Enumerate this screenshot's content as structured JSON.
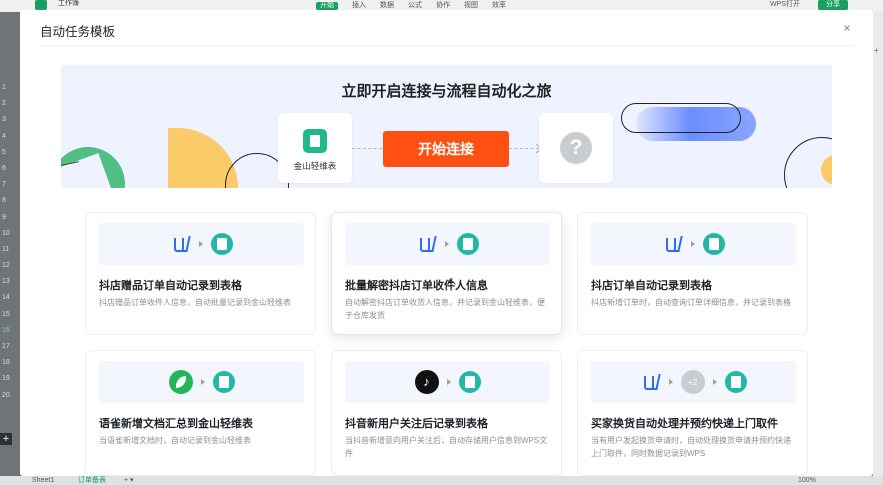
{
  "background": {
    "doc_title": "工作簿",
    "menu": [
      "开始",
      "插入",
      "数据",
      "公式",
      "协作",
      "视图",
      "效率"
    ],
    "right_label": "WPS打开",
    "share_label": "分享",
    "row_numbers": [
      "1",
      "2",
      "3",
      "4",
      "5",
      "6",
      "7",
      "8",
      "9",
      "10",
      "11",
      "12",
      "13",
      "14",
      "15",
      "16",
      "17",
      "18",
      "19",
      "20"
    ],
    "sheets": [
      "Sheet1",
      "订单备表",
      "+ ▾"
    ],
    "zoom": "100%"
  },
  "modal": {
    "title": "自动任务模板",
    "close_glyph": "×"
  },
  "banner": {
    "title": "立即开启连接与流程自动化之旅",
    "left_app_label": "金山轻维表",
    "start_button": "开始连接",
    "unknown_glyph": "?"
  },
  "cards": [
    {
      "title": "抖店赠品订单自动记录到表格",
      "desc": "抖店赠品订单收件人信息，自动批量记录到金山轻维表"
    },
    {
      "title": "批量解密抖店订单收件人信息",
      "desc": "自动解密抖店订单收货人信息，并记录到金山轻维表，便于仓库发货"
    },
    {
      "title": "抖店订单自动记录到表格",
      "desc": "抖店新增订单时，自动查询订单详细信息，并记录到表格"
    },
    {
      "title": "语雀新增文档汇总到金山轻维表",
      "desc": "当语雀新增文档时，自动记录到金山轻维表"
    },
    {
      "title": "抖音新用户关注后记录到表格",
      "desc": "当抖音新增意向用户关注后，自动存储用户信息到WPS文件"
    },
    {
      "title": "买家换货自动处理并预约快递上门取件",
      "desc": "当有用户发起换货申请时，自动处理换货申请并预约快递上门取件，同时数据记录到WPS",
      "extra_badge": "+2"
    }
  ],
  "icons": {
    "tiktok_glyph": "♪"
  },
  "colors": {
    "accent": "#ff5012",
    "brand_green": "#19a05f",
    "app_teal": "#23b8a6",
    "banner_bg": "#eef3ff"
  }
}
